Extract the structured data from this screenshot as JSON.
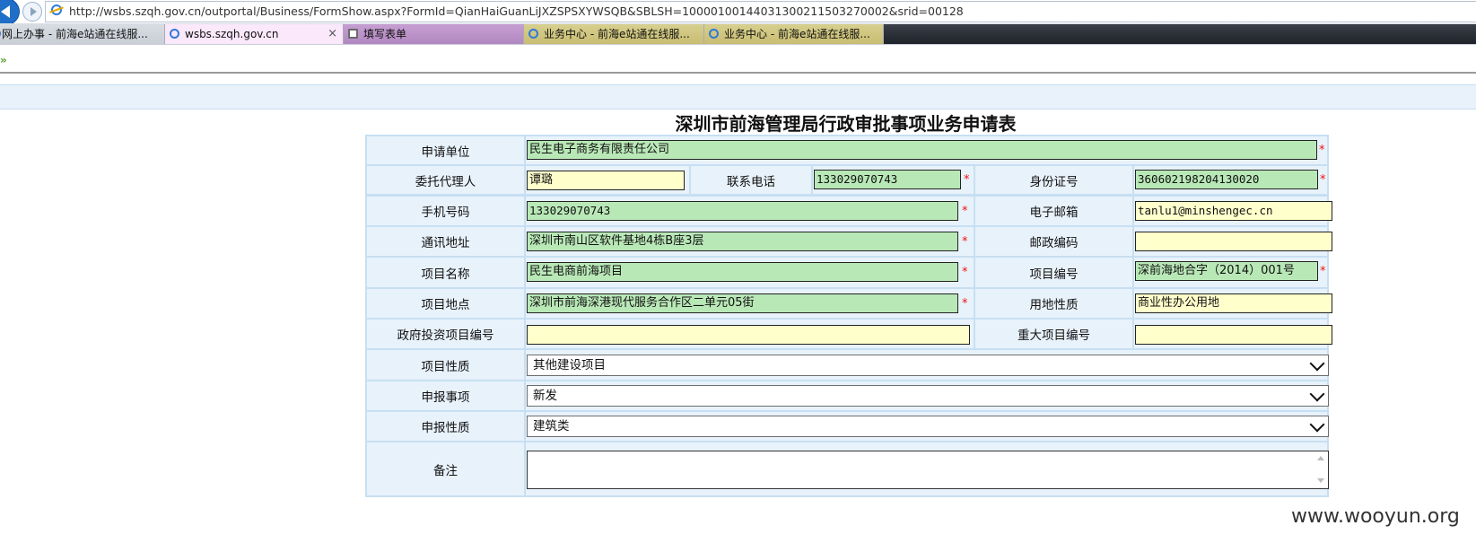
{
  "browser": {
    "url": "http://wsbs.szqh.gov.cn/outportal/Business/FormShow.aspx?FormId=QianHaiGuanLiJXZSPSXYWSQB&SBLSH=10000100144031300211503270002&srid=00128",
    "tabs": [
      {
        "label": "网上办事 - 前海e站通在线服..."
      },
      {
        "label": "wsbs.szqh.gov.cn",
        "close": "×"
      },
      {
        "label": "填写表单"
      },
      {
        "label": "业务中心 - 前海e站通在线服..."
      },
      {
        "label": "业务中心 - 前海e站通在线服..."
      }
    ]
  },
  "form": {
    "title": "深圳市前海管理局行政审批事项业务申请表",
    "required_mark": "*",
    "fields": {
      "applicant_org": {
        "label": "申请单位",
        "value": "民生电子商务有限责任公司"
      },
      "agent": {
        "label": "委托代理人",
        "value": "谭璐"
      },
      "contact_phone": {
        "label": "联系电话",
        "value": "133029070743"
      },
      "id_number": {
        "label": "身份证号",
        "value": "360602198204130020"
      },
      "mobile": {
        "label": "手机号码",
        "value": "133029070743"
      },
      "email": {
        "label": "电子邮箱",
        "value": "tanlu1@minshengec.cn"
      },
      "address": {
        "label": "通讯地址",
        "value": "深圳市南山区软件基地4栋B座3层"
      },
      "postcode": {
        "label": "邮政编码",
        "value": ""
      },
      "project_name": {
        "label": "项目名称",
        "value": "民生电商前海项目"
      },
      "project_no": {
        "label": "项目编号",
        "value": "深前海地合字（2014）001号"
      },
      "project_site": {
        "label": "项目地点",
        "value": "深圳市前海深港现代服务合作区二单元05街"
      },
      "land_use": {
        "label": "用地性质",
        "value": "商业性办公用地"
      },
      "gov_invest_no": {
        "label": "政府投资项目编号",
        "value": ""
      },
      "major_project_no": {
        "label": "重大项目编号",
        "value": ""
      },
      "project_nature": {
        "label": "项目性质",
        "value": "其他建设项目"
      },
      "report_item": {
        "label": "申报事项",
        "value": "新发"
      },
      "report_nature": {
        "label": "申报性质",
        "value": "建筑类"
      },
      "remarks": {
        "label": "备注",
        "value": ""
      }
    }
  },
  "watermark": "www.wooyun.org"
}
